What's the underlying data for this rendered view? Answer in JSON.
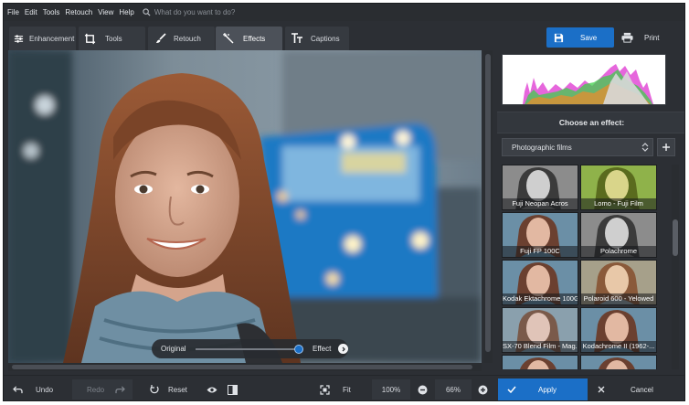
{
  "menu": {
    "items": [
      "File",
      "Edit",
      "Tools",
      "Retouch",
      "View",
      "Help"
    ],
    "search_placeholder": "What do you want to do?"
  },
  "tabs": [
    {
      "label": "Enhancement",
      "icon": "sliders-icon"
    },
    {
      "label": "Tools",
      "icon": "crop-icon"
    },
    {
      "label": "Retouch",
      "icon": "brush-icon"
    },
    {
      "label": "Effects",
      "icon": "magic-wand-icon",
      "active": true
    },
    {
      "label": "Captions",
      "icon": "text-icon"
    }
  ],
  "toolbar": {
    "save_label": "Save",
    "print_label": "Print"
  },
  "compare": {
    "original_label": "Original",
    "effect_label": "Effect"
  },
  "panel": {
    "header": "Choose an effect:",
    "category": "Photographic films",
    "effects": [
      {
        "label": "Fuji Neopan Acros",
        "tone": "bw"
      },
      {
        "label": "Lomo - Fuji Film",
        "tone": "green"
      },
      {
        "label": "Fuji FP 100C",
        "tone": "cool"
      },
      {
        "label": "Polachrome",
        "tone": "bw"
      },
      {
        "label": "Kodak Ektachrome 100G",
        "tone": "cool"
      },
      {
        "label": "Polaroid 600 - Yelowed",
        "tone": "warm"
      },
      {
        "label": "SX-70 Blend Film - Mag...",
        "tone": "faded"
      },
      {
        "label": "Kodachrome II (1962-...",
        "tone": "cool"
      },
      {
        "label": "",
        "tone": "cool"
      },
      {
        "label": "",
        "tone": "cool"
      }
    ]
  },
  "bottom": {
    "undo_label": "Undo",
    "redo_label": "Redo",
    "reset_label": "Reset",
    "fit_label": "Fit",
    "zoom_100": "100%",
    "zoom_value": "66%",
    "apply_label": "Apply",
    "cancel_label": "Cancel"
  },
  "colors": {
    "accent": "#1b6fc7",
    "panel": "#2c2f34"
  }
}
